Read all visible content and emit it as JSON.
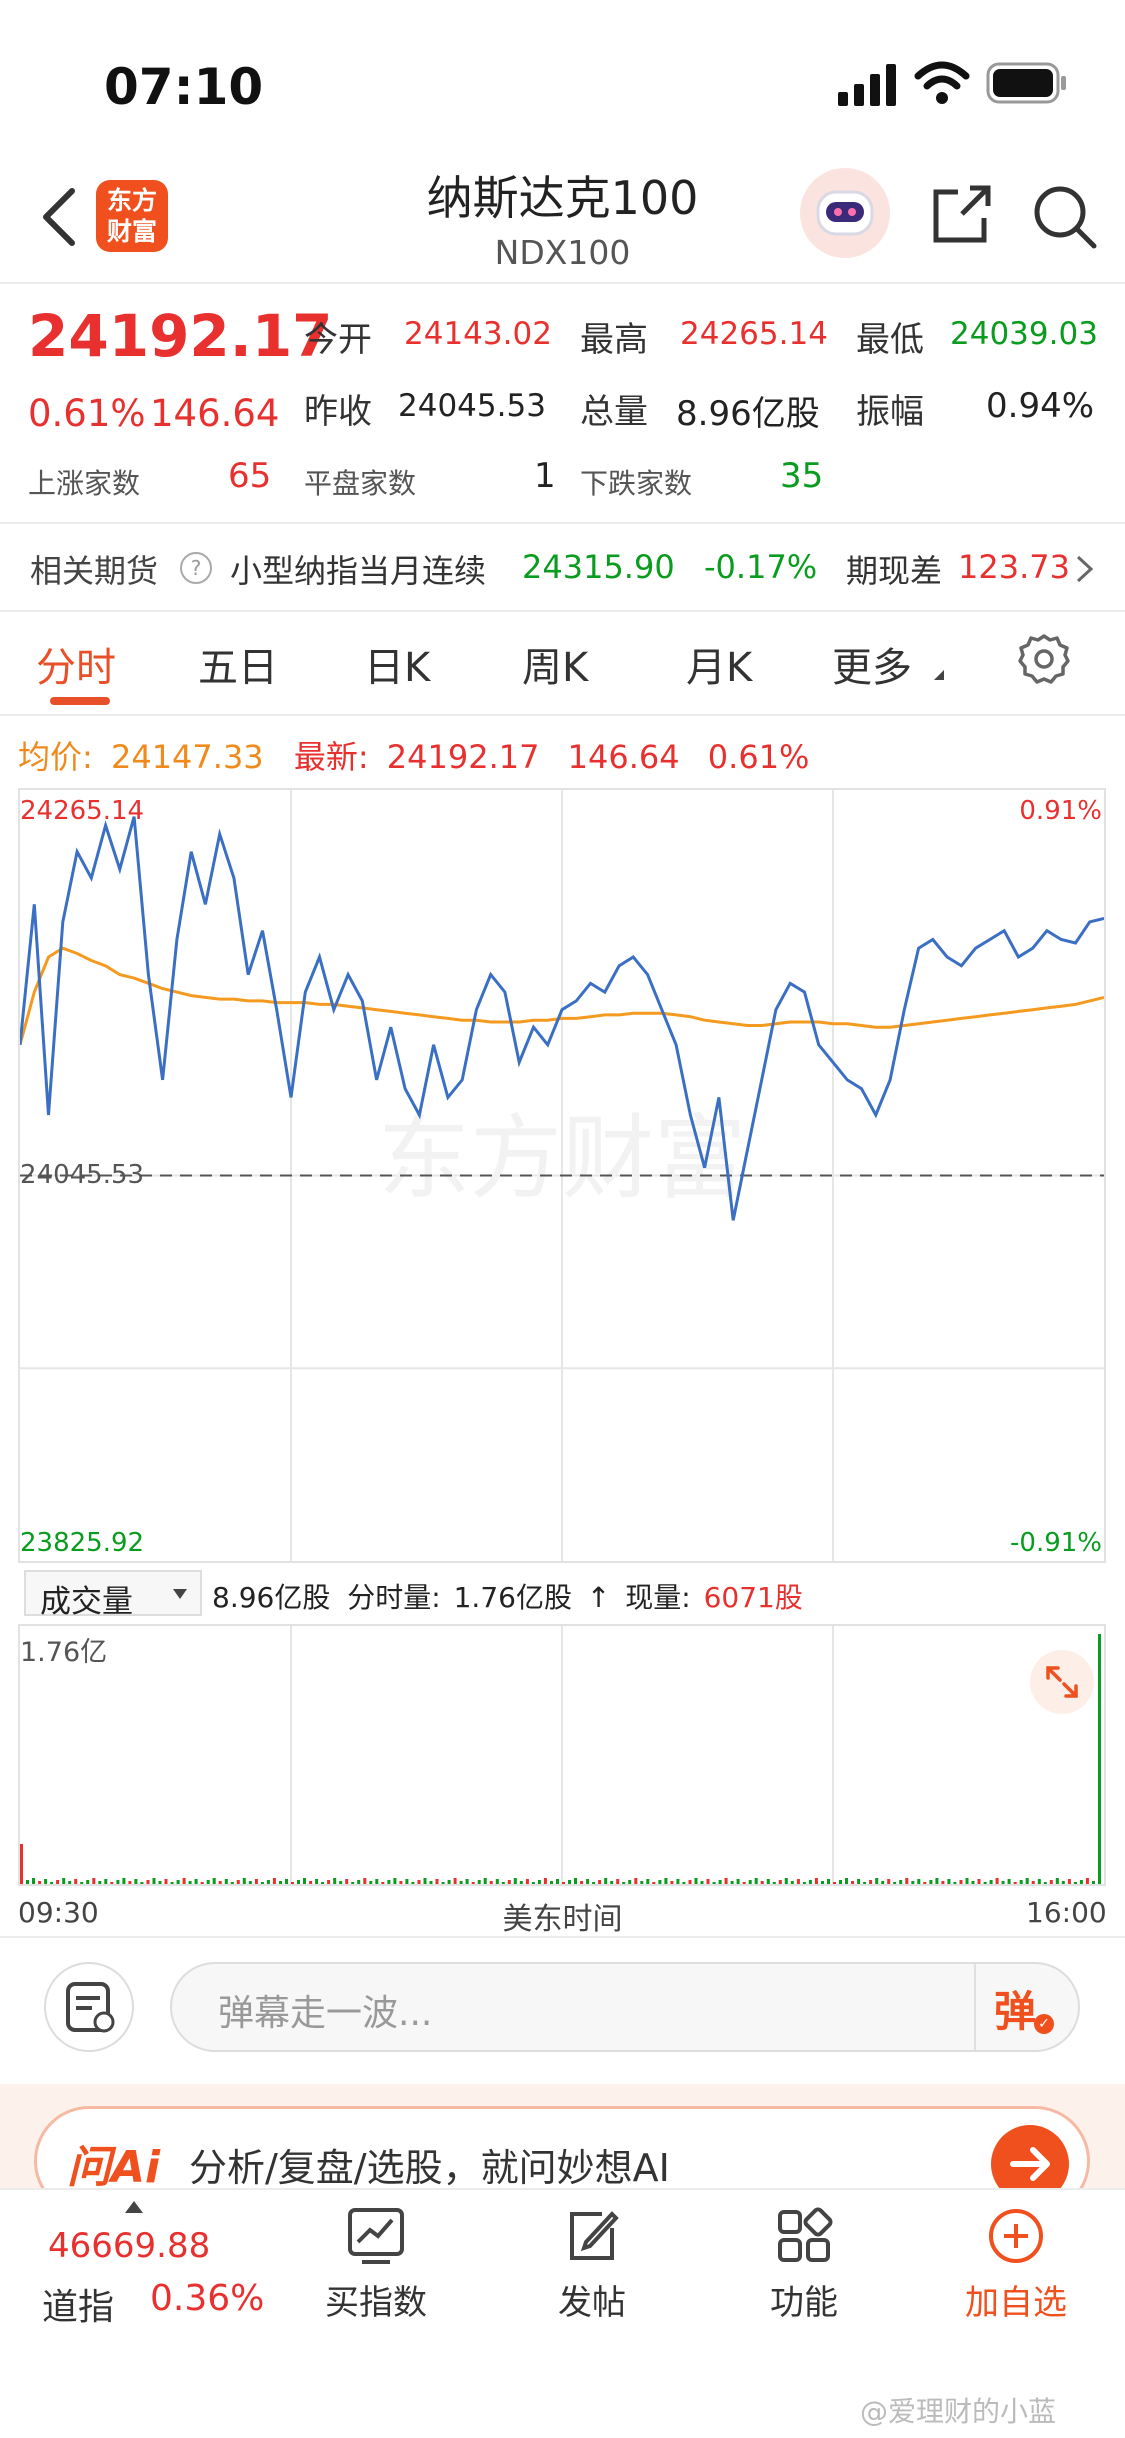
{
  "status_bar": {
    "time": "07:10"
  },
  "header": {
    "logo_text": "东方财富",
    "title": "纳斯达克100",
    "subtitle": "NDX100"
  },
  "quote": {
    "price": "24192.17",
    "change_pct": "0.61%",
    "change": "146.64",
    "open_label": "今开",
    "open": "24143.02",
    "high_label": "最高",
    "high": "24265.14",
    "low_label": "最低",
    "low": "24039.03",
    "prev_close_label": "昨收",
    "prev_close": "24045.53",
    "volume_label": "总量",
    "volume": "8.96亿股",
    "amplitude_label": "振幅",
    "amplitude": "0.94%",
    "up_label": "上涨家数",
    "up": "65",
    "flat_label": "平盘家数",
    "flat": "1",
    "down_label": "下跌家数",
    "down": "35"
  },
  "futures": {
    "label": "相关期货",
    "name": "小型纳指当月连续",
    "price": "24315.90",
    "change": "-0.17%",
    "basis_label": "期现差",
    "basis": "123.73"
  },
  "tabs": [
    "分时",
    "五日",
    "日K",
    "周K",
    "月K",
    "更多"
  ],
  "chart_info": {
    "avg_label": "均价:",
    "avg": "24147.33",
    "latest_label": "最新:",
    "latest": "24192.17",
    "latest_change": "146.64",
    "latest_pct": "0.61%"
  },
  "chart_data": {
    "type": "line",
    "title": "",
    "x_start": "09:30",
    "x_end": "16:00",
    "x_center_label": "美东时间",
    "ylim": [
      23825.92,
      24265.14
    ],
    "y_top_label": "24265.14",
    "y_bottom_label": "23825.92",
    "y_ref_label": "24045.53",
    "pct_top": "0.91%",
    "pct_bottom": "-0.91%",
    "watermark": "东方财富",
    "series": [
      {
        "name": "price",
        "color": "#3a6fc4",
        "values": [
          24120,
          24200,
          24080,
          24190,
          24230,
          24215,
          24245,
          24220,
          24250,
          24160,
          24100,
          24180,
          24230,
          24200,
          24240,
          24215,
          24160,
          24185,
          24140,
          24090,
          24150,
          24170,
          24140,
          24160,
          24145,
          24100,
          24130,
          24095,
          24080,
          24120,
          24090,
          24100,
          24140,
          24160,
          24150,
          24110,
          24130,
          24120,
          24140,
          24145,
          24155,
          24150,
          24165,
          24170,
          24160,
          24140,
          24120,
          24080,
          24050,
          24090,
          24020,
          24060,
          24100,
          24140,
          24155,
          24150,
          24120,
          24110,
          24100,
          24095,
          24080,
          24100,
          24140,
          24175,
          24180,
          24170,
          24165,
          24175,
          24180,
          24185,
          24170,
          24175,
          24185,
          24180,
          24178,
          24190,
          24192
        ]
      },
      {
        "name": "avg",
        "color": "#f39a1f",
        "values": [
          24120,
          24150,
          24170,
          24175,
          24172,
          24168,
          24165,
          24160,
          24158,
          24155,
          24152,
          24150,
          24148,
          24147,
          24146,
          24146,
          24145,
          24145,
          24144,
          24144,
          24144,
          24143,
          24143,
          24142,
          24141,
          24140,
          24139,
          24138,
          24137,
          24136,
          24135,
          24134,
          24134,
          24133,
          24133,
          24133,
          24134,
          24134,
          24135,
          24135,
          24136,
          24137,
          24137,
          24138,
          24138,
          24138,
          24137,
          24136,
          24134,
          24133,
          24132,
          24131,
          24131,
          24132,
          24133,
          24133,
          24133,
          24132,
          24132,
          24131,
          24130,
          24130,
          24131,
          24132,
          24133,
          24134,
          24135,
          24136,
          24137,
          24138,
          24139,
          24140,
          24141,
          24142,
          24143,
          24145,
          24147
        ]
      }
    ]
  },
  "volume": {
    "selector": "成交量",
    "total": "8.96亿股",
    "minute_label": "分时量:",
    "minute_value": "1.76亿股",
    "arrow": "↑",
    "current_label": "现量:",
    "current_value": "6071股",
    "y_max_label": "1.76亿"
  },
  "comment": {
    "placeholder": "弹幕走一波...",
    "send_label": "弹"
  },
  "ai_banner": {
    "brand": "问Ai",
    "text": "分析/复盘/选股，就问妙想AI"
  },
  "bottom_nav": {
    "index_value": "46669.88",
    "index_name": "道指",
    "index_pct": "0.36%",
    "items": [
      "买指数",
      "发帖",
      "功能",
      "加自选"
    ]
  },
  "watermark_user": "@爱理财的小蓝",
  "colors": {
    "up": "#e8312f",
    "down": "#0a9c1e",
    "accent": "#f0501e"
  }
}
